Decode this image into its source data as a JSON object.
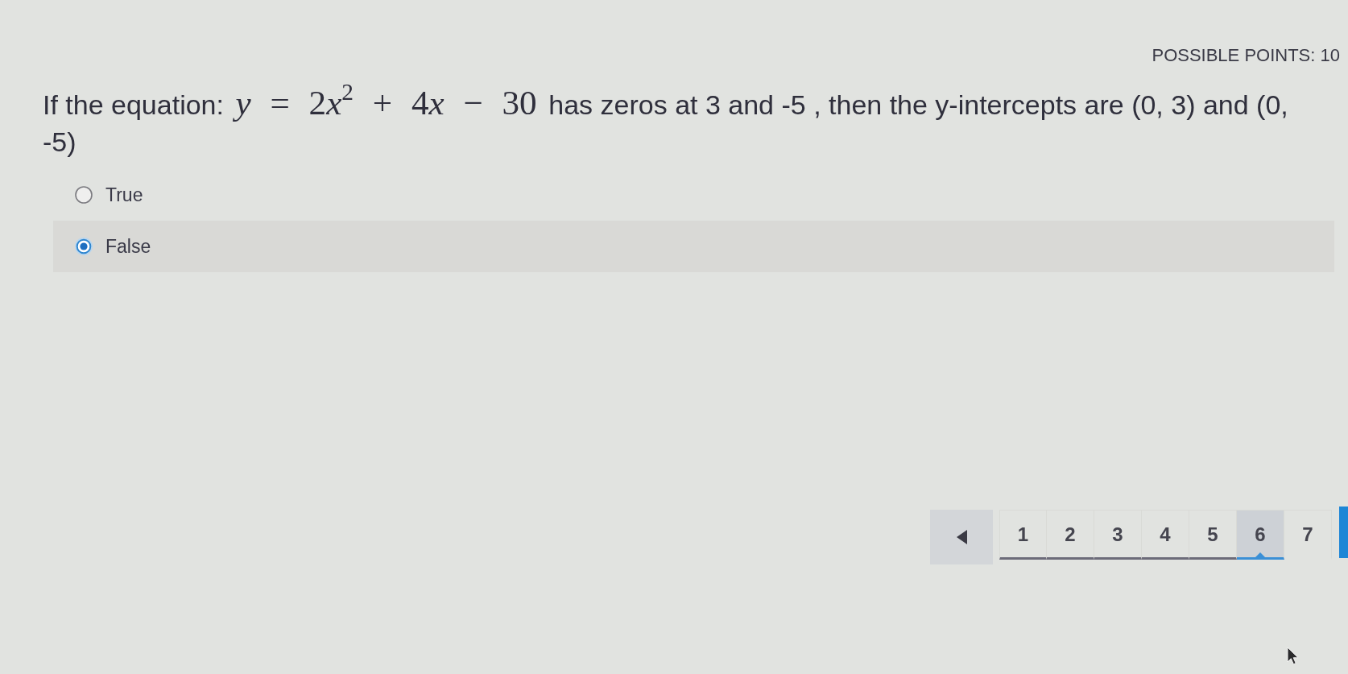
{
  "header": {
    "points": "POSSIBLE POINTS: 10"
  },
  "question": {
    "text_before": "If the equation:",
    "equation": "y = 2x$^{2}$ + 4x − 30",
    "text_after": "has zeros at 3 and -5 , then the y-intercepts are (0, 3) and (0, -5)"
  },
  "options": [
    {
      "label": "True",
      "selected": false
    },
    {
      "label": "False",
      "selected": true
    }
  ],
  "pagination": {
    "pages": [
      {
        "label": "1",
        "visited": true,
        "selected": false
      },
      {
        "label": "2",
        "visited": true,
        "selected": false
      },
      {
        "label": "3",
        "visited": true,
        "selected": false
      },
      {
        "label": "4",
        "visited": true,
        "selected": false
      },
      {
        "label": "5",
        "visited": true,
        "selected": false
      },
      {
        "label": "6",
        "visited": true,
        "selected": true
      },
      {
        "label": "7",
        "visited": false,
        "selected": false
      }
    ]
  }
}
